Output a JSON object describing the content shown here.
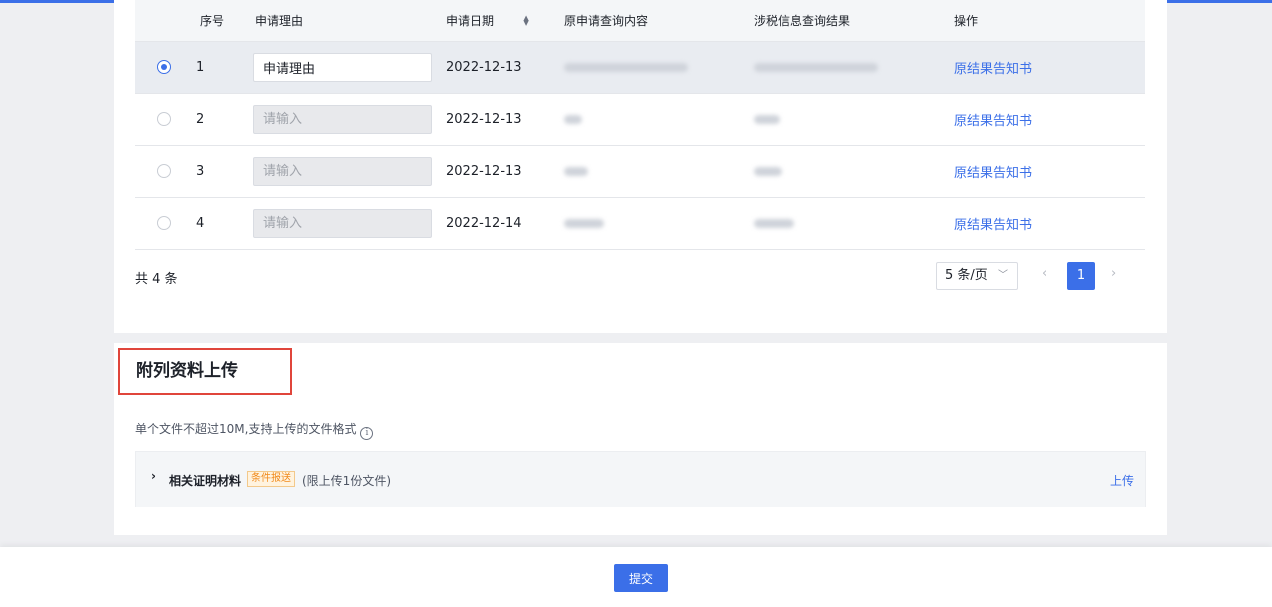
{
  "table": {
    "headers": {
      "seq": "序号",
      "reason": "申请理由",
      "date": "申请日期",
      "query": "原申请查询内容",
      "result": "涉税信息查询结果",
      "op": "操作"
    },
    "rows": [
      {
        "seq": "1",
        "reason_value": "申请理由",
        "reason_placeholder": "请输入",
        "date": "2022-12-13",
        "link": "原结果告知书",
        "selected": true
      },
      {
        "seq": "2",
        "reason_value": "",
        "reason_placeholder": "请输入",
        "date": "2022-12-13",
        "link": "原结果告知书",
        "selected": false
      },
      {
        "seq": "3",
        "reason_value": "",
        "reason_placeholder": "请输入",
        "date": "2022-12-13",
        "link": "原结果告知书",
        "selected": false
      },
      {
        "seq": "4",
        "reason_value": "",
        "reason_placeholder": "请输入",
        "date": "2022-12-14",
        "link": "原结果告知书",
        "selected": false
      }
    ]
  },
  "pagination": {
    "total": "共 4 条",
    "page_size": "5 条/页",
    "current_page": "1"
  },
  "upload": {
    "title": "附列资料上传",
    "note": "单个文件不超过10M,支持上传的文件格式",
    "material_label": "相关证明材料",
    "badge": "条件报送",
    "limit": "(限上传1份文件)",
    "upload_link": "上传"
  },
  "footer": {
    "submit": "提交"
  },
  "colors": {
    "primary": "#3b6fe8",
    "highlight_border": "#e0453b",
    "badge_text": "#f08a1c"
  }
}
